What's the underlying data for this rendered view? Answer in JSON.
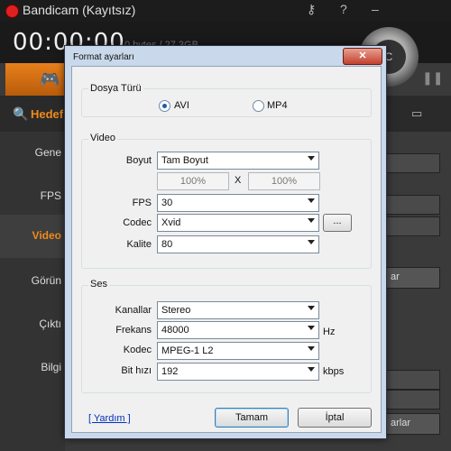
{
  "app": {
    "title": "Bandicam (Kayıtsız)",
    "timer": "00:00:00",
    "size": "0 bytes / 27.3GB",
    "rec_label": "C",
    "subheader": "Hedef p",
    "sidebar": [
      "Gene",
      "FPS",
      "Video",
      "Görün",
      "Çıktı",
      "Bilgi"
    ],
    "right_buttons": [
      "ar",
      "arlar"
    ],
    "key_icon": "⚷",
    "help_icon": "?",
    "min_icon": "–",
    "search_icon": "🔍",
    "gamepad_icon": "🎮",
    "pause_icon": "❚❚",
    "window_icon": "▭"
  },
  "dialog": {
    "title": "Format ayarları",
    "close": "✕",
    "file_type": {
      "group": "Dosya Türü",
      "avi": "AVI",
      "mp4": "MP4",
      "selected": "AVI"
    },
    "video": {
      "group": "Video",
      "size_label": "Boyut",
      "size_value": "Tam Boyut",
      "width_pct": "100%",
      "x_sep": "X",
      "height_pct": "100%",
      "fps_label": "FPS",
      "fps_value": "30",
      "codec_label": "Codec",
      "codec_value": "Xvid",
      "codec_more": "...",
      "quality_label": "Kalite",
      "quality_value": "80"
    },
    "audio": {
      "group": "Ses",
      "channels_label": "Kanallar",
      "channels_value": "Stereo",
      "freq_label": "Frekans",
      "freq_value": "48000",
      "freq_unit": "Hz",
      "codec_label": "Kodec",
      "codec_value": "MPEG-1 L2",
      "bitrate_label": "Bit hızı",
      "bitrate_value": "192",
      "bitrate_unit": "kbps"
    },
    "help": "[ Yardım ]",
    "ok": "Tamam",
    "cancel": "İptal"
  }
}
